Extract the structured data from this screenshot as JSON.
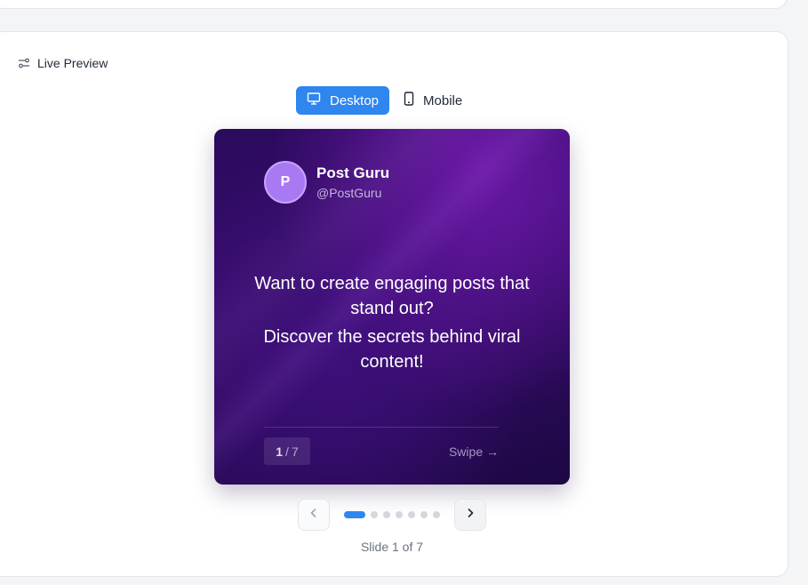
{
  "preview": {
    "title": "Live Preview",
    "title_icon": "sliders-icon",
    "modes": [
      {
        "label": "Desktop",
        "icon": "monitor-icon",
        "active": true
      },
      {
        "label": "Mobile",
        "icon": "smartphone-icon",
        "active": false
      }
    ]
  },
  "slide": {
    "avatar_initial": "P",
    "author_name": "Post Guru",
    "author_handle": "@PostGuru",
    "text_line_1": "Want to create engaging posts that stand out?",
    "text_line_2": "Discover the secrets behind viral content!",
    "counter_current": "1",
    "counter_separator": "/",
    "counter_total": "7",
    "swipe_label": "Swipe →"
  },
  "carousel": {
    "prev_icon": "chevron-left-icon",
    "next_icon": "chevron-right-icon",
    "total_slides": 7,
    "active_index": 0,
    "caption": "Slide 1 of 7"
  },
  "colors": {
    "accent": "#2f86ee",
    "avatar": "#a879f2",
    "slide_bg_dark": "#1c0843",
    "slide_bg_mid": "#3a0c70"
  }
}
